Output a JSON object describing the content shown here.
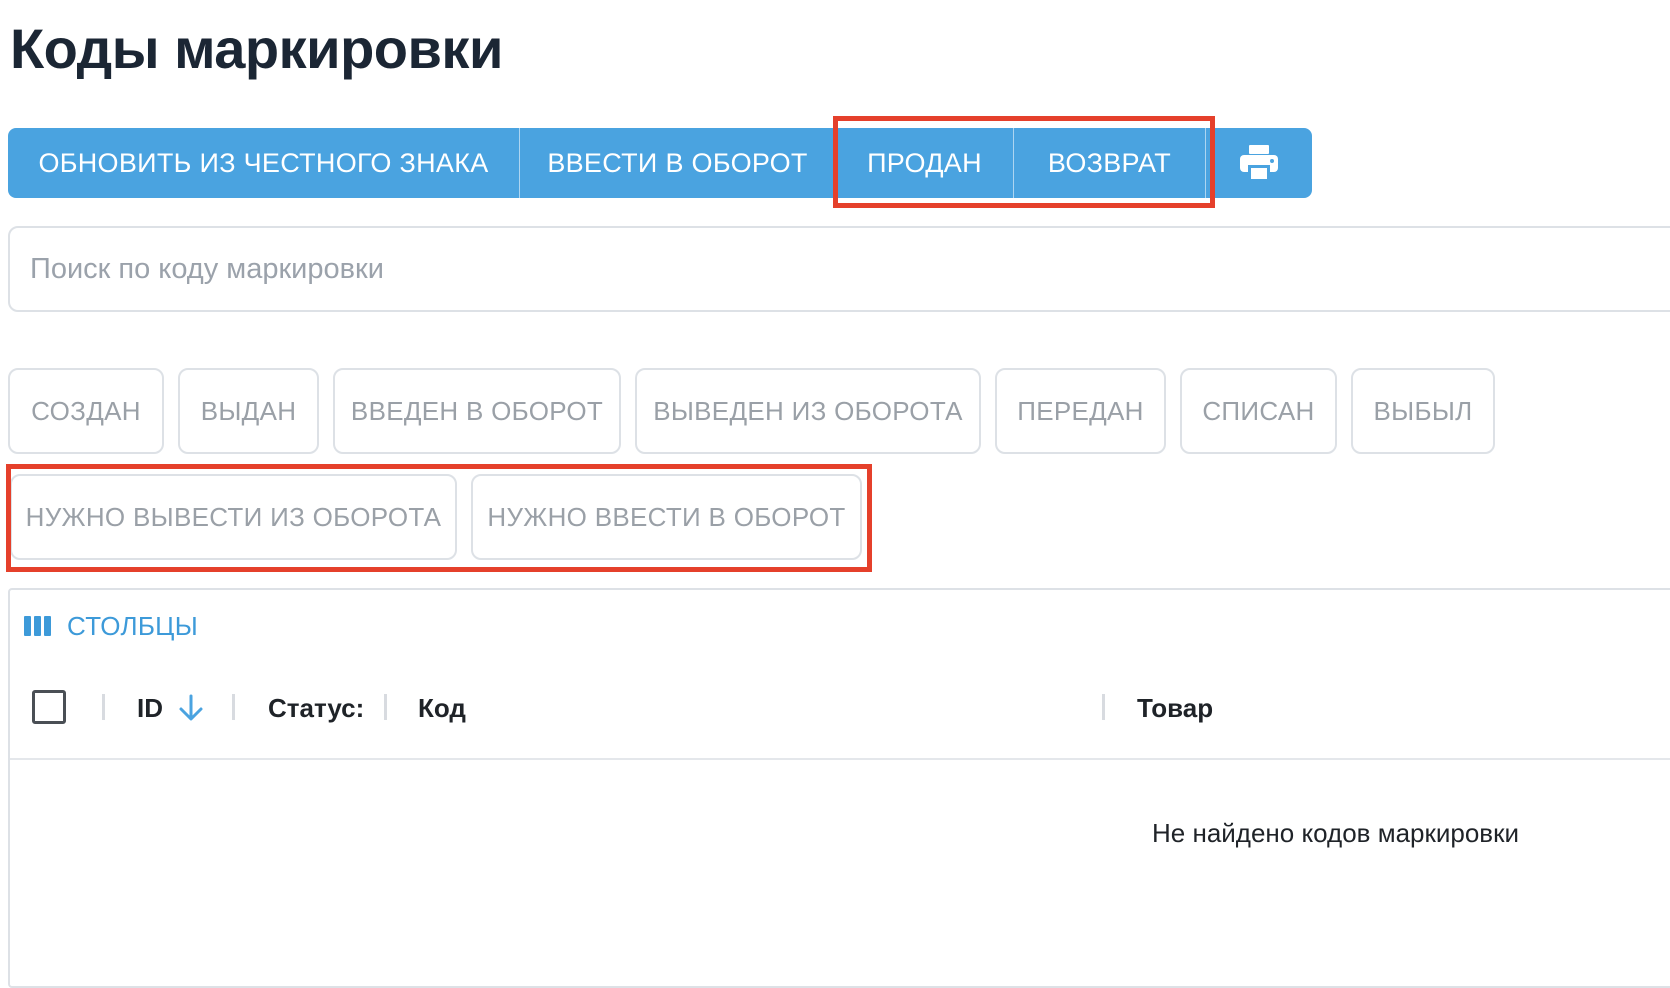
{
  "page": {
    "title": "Коды маркировки"
  },
  "toolbar": {
    "update_label": "ОБНОВИТЬ ИЗ ЧЕСТНОГО ЗНАКА",
    "introduce_label": "ВВЕСТИ В ОБОРОТ",
    "sold_label": "ПРОДАН",
    "return_label": "ВОЗВРАТ",
    "print_icon": "printer-icon"
  },
  "search": {
    "placeholder": "Поиск по коду маркировки",
    "value": ""
  },
  "filters": [
    "СОЗДАН",
    "ВЫДАН",
    "ВВЕДЕН В ОБОРОТ",
    "ВЫВЕДЕН ИЗ ОБОРОТА",
    "ПЕРЕДАН",
    "СПИСАН",
    "ВЫБЫЛ",
    "НУЖНО ВЫВЕСТИ ИЗ ОБОРОТА",
    "НУЖНО ВВЕСТИ В ОБОРОТ"
  ],
  "table": {
    "columns_label": "СТОЛБЦЫ",
    "columns_icon": "columns-icon",
    "headers": {
      "id": "ID",
      "status": "Статус:",
      "code": "Код",
      "product": "Товар"
    },
    "sort_icon": "arrow-down-icon",
    "empty_message": "Не найдено кодов маркировки"
  },
  "colors": {
    "accent": "#4aa3e0",
    "highlight": "#e5402b",
    "chip_text": "#9aa0a7",
    "title": "#1b2634"
  }
}
